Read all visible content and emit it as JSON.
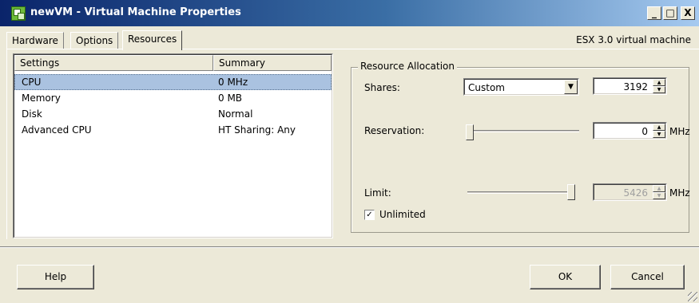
{
  "window": {
    "title": "newVM - Virtual Machine Properties",
    "minimize_glyph": "_",
    "maximize_glyph": "□",
    "close_glyph": "X"
  },
  "tabs": [
    {
      "label": "Hardware"
    },
    {
      "label": "Options"
    },
    {
      "label": "Resources"
    }
  ],
  "esx_label": "ESX 3.0 virtual machine",
  "settings_table": {
    "headers": [
      "Settings",
      "Summary"
    ],
    "rows": [
      {
        "setting": "CPU",
        "summary": "0 MHz"
      },
      {
        "setting": "Memory",
        "summary": "0 MB"
      },
      {
        "setting": "Disk",
        "summary": "Normal"
      },
      {
        "setting": "Advanced CPU",
        "summary": "HT Sharing: Any"
      }
    ]
  },
  "resource_allocation": {
    "legend": "Resource Allocation",
    "shares_label": "Shares:",
    "shares_value": "Custom",
    "shares_number": "3192",
    "reservation_label": "Reservation:",
    "reservation_value": "0",
    "reservation_unit": "MHz",
    "limit_label": "Limit:",
    "limit_value": "5426",
    "limit_unit": "MHz",
    "unlimited_label": "Unlimited",
    "unlimited_checked": true
  },
  "buttons": {
    "help": "Help",
    "ok": "OK",
    "cancel": "Cancel"
  }
}
